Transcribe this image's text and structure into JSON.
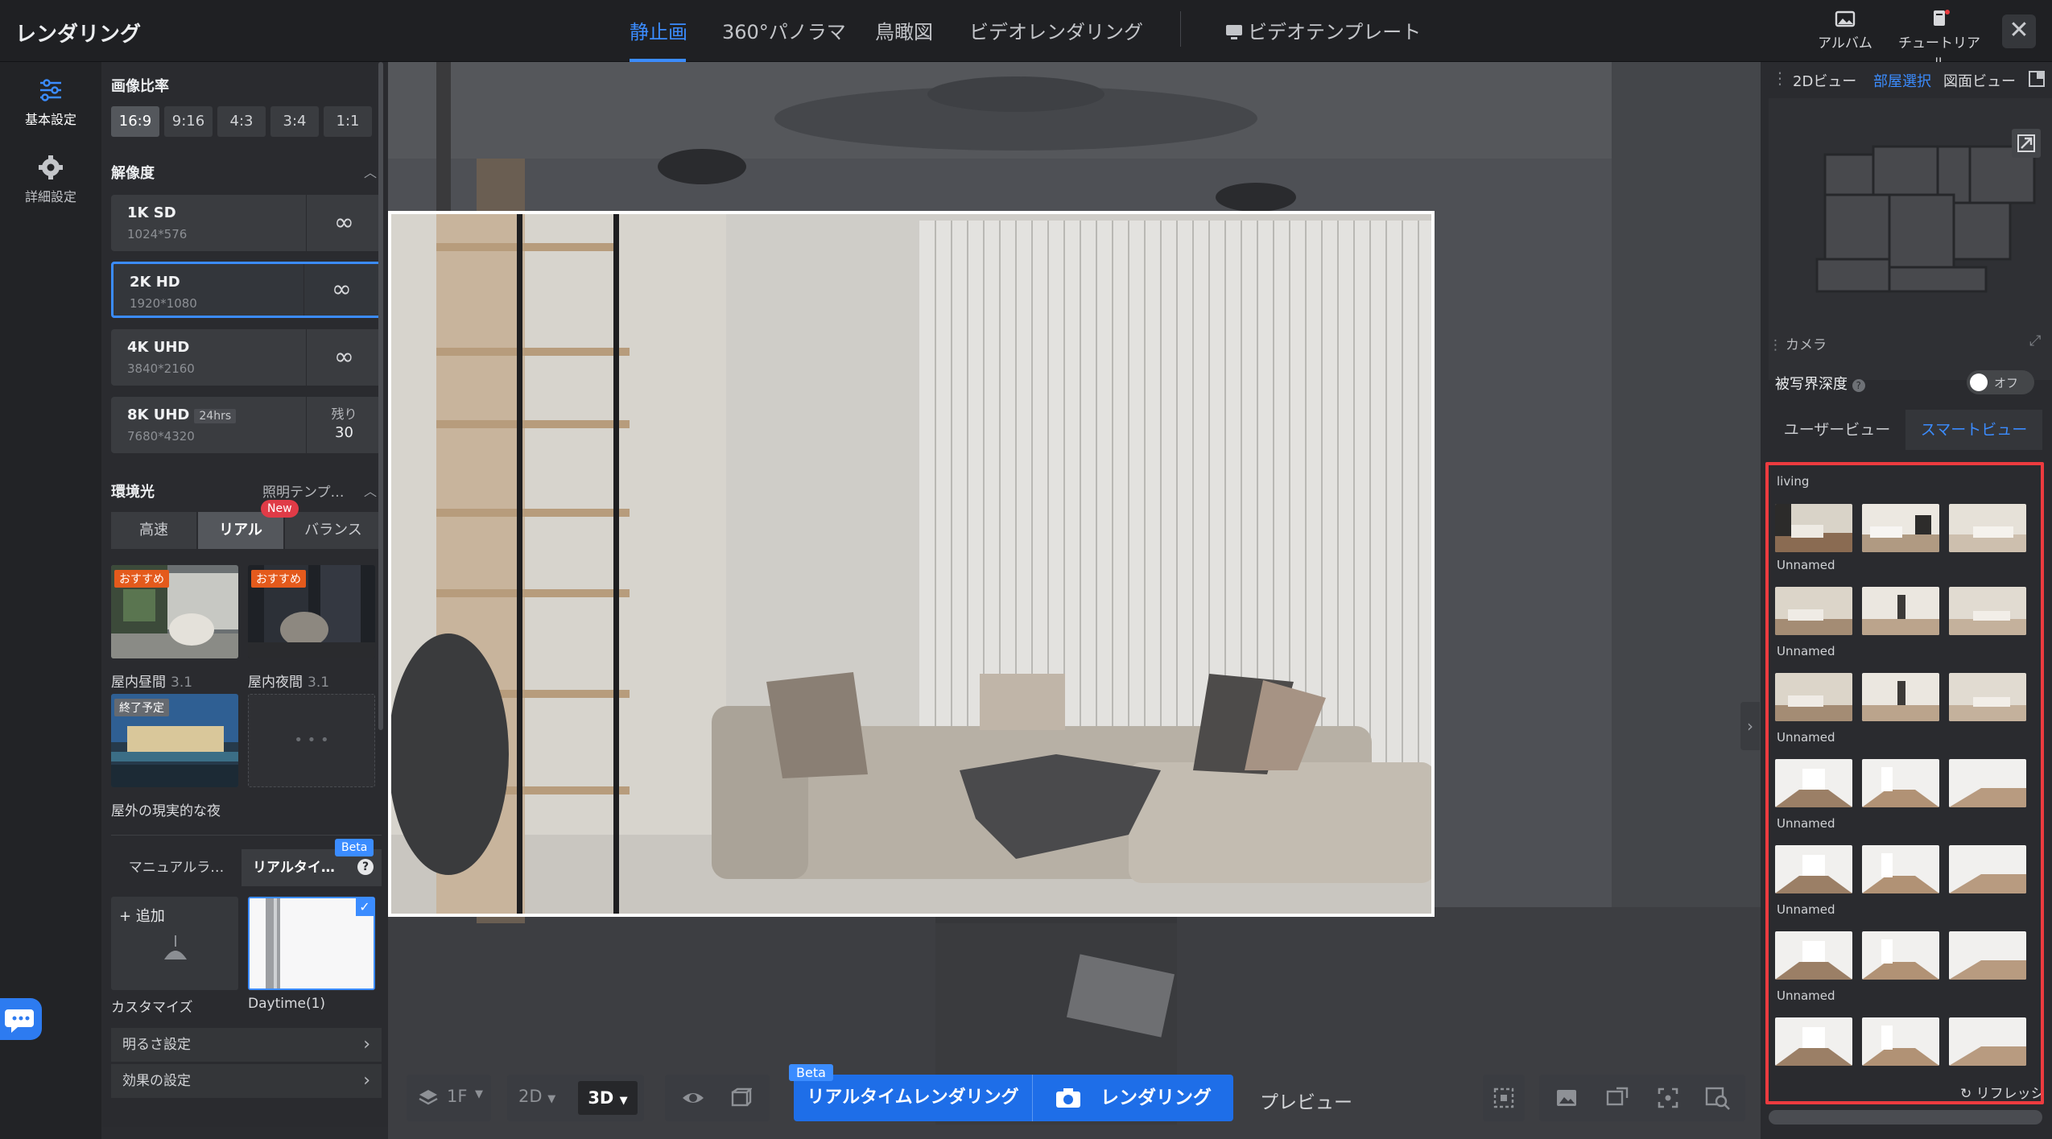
{
  "app": {
    "title": "レンダリング"
  },
  "mode_tabs": [
    {
      "label": "静止画",
      "active": true
    },
    {
      "label": "360°パノラマ",
      "active": false
    },
    {
      "label": "鳥瞰図",
      "active": false
    },
    {
      "label": "ビデオレンダリング",
      "active": false
    }
  ],
  "video_template": {
    "label": "ビデオテンプレート"
  },
  "top_actions": {
    "album": "アルバム",
    "tutorial": "チュートリアル",
    "close": "✕"
  },
  "rail": {
    "basic": "基本設定",
    "advanced": "詳細設定"
  },
  "aspect": {
    "title": "画像比率",
    "options": [
      "16:9",
      "9:16",
      "4:3",
      "3:4",
      "1:1"
    ],
    "selected": "16:9"
  },
  "resolution": {
    "title": "解像度",
    "options": [
      {
        "name": "1K SD",
        "dim": "1024*576",
        "right": "∞"
      },
      {
        "name": "2K HD",
        "dim": "1920*1080",
        "right": "∞",
        "selected": true
      },
      {
        "name": "4K UHD",
        "dim": "3840*2160",
        "right": "∞"
      },
      {
        "name": "8K UHD",
        "badge": "24hrs",
        "dim": "7680*4320",
        "right_label": "残り",
        "right_value": "30"
      }
    ]
  },
  "environment": {
    "title": "環境光",
    "template_link": "照明テンプ…",
    "tabs": [
      "高速",
      "リアル",
      "バランス"
    ],
    "active_tab": "リアル",
    "new_badge": "New",
    "presets": [
      {
        "tag": "おすすめ",
        "label": "屋内昼間",
        "version": "3.1"
      },
      {
        "tag": "おすすめ",
        "label": "屋内夜間",
        "version": "3.1"
      },
      {
        "tag": "終了予定",
        "label": "屋外の現実的な夜"
      }
    ],
    "more": "• • •"
  },
  "lighting": {
    "tabs": [
      "マニュアルラ…",
      "リアルタイ…"
    ],
    "beta": "Beta",
    "add_label": "+ 追加",
    "customize_label": "カスタマイズ",
    "daytime_label": "Daytime(1)"
  },
  "menus": {
    "brightness": "明るさ設定",
    "effects": "効果の設定"
  },
  "toolbar": {
    "floor": "1F",
    "view2d": "2D",
    "view3d": "3D",
    "beta": "Beta",
    "realtime": "リアルタイムレンダリング",
    "render": "レンダリング",
    "preview": "プレビュー"
  },
  "right_panel": {
    "tabs": [
      "2Dビュー",
      "部屋選択",
      "図面ビュー"
    ],
    "active_tab": "部屋選択",
    "camera_header": "カメラ",
    "dof_label": "被写界深度",
    "dof_state": "オフ",
    "view_tabs": [
      "ユーザービュー",
      "スマートビュー"
    ],
    "active_view": "スマートビュー",
    "groups": [
      "living",
      "Unnamed",
      "Unnamed",
      "Unnamed",
      "Unnamed",
      "Unnamed",
      "Unnamed"
    ],
    "refresh": "リフレッシ"
  },
  "colors": {
    "accent": "#3b8cff",
    "highlight_frame": "#ec3b3f",
    "primary_button": "#1e6ee8",
    "new_badge": "#e03b47",
    "recommend_tag": "#e45a1c"
  }
}
